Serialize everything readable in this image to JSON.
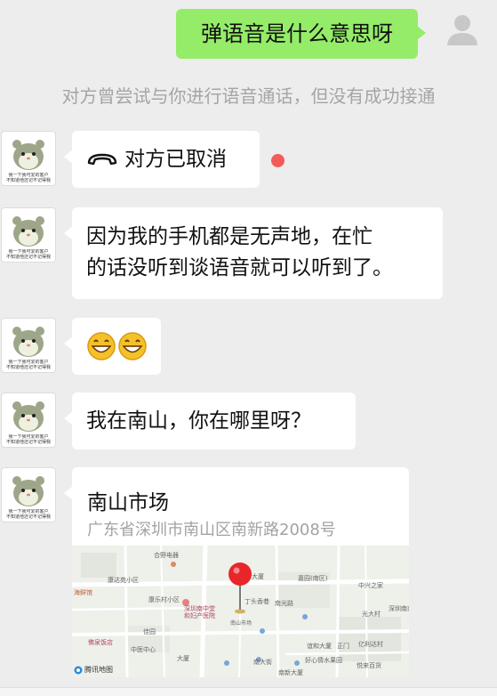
{
  "chat": {
    "outgoing_message": "弹语音是什么意思呀",
    "system_notice": "对方曾尝试与你进行语音通话，但没有成功接通",
    "call_cancelled_text": "对方已取消",
    "message_2": "因为我的手机都是无声地，在忙的话没听到谈语音就可以听到了。",
    "message_2_line1": "因为我的手机都是无声地，在忙",
    "message_2_line2": "的话没听到谈语音就可以听到了。",
    "emoji_message": "😁😁",
    "message_4": "我在南山，你在哪里呀？"
  },
  "contact": {
    "avatar_caption_line1": "我一下我可爱的客户",
    "avatar_caption_line2": "不知道他还记不记得我"
  },
  "location": {
    "name": "南山市场",
    "address": "广东省深圳市南山区南新路2008号",
    "map_provider": "腾讯地图",
    "pin_label": "南山市场",
    "map_labels": [
      "合野电器",
      "康达苑小区",
      "海鲜馆",
      "康乐村小区",
      "深圳南中堂",
      "和妇产医院",
      "丁头香巷",
      "大厦",
      "嘉园(南区)",
      "中兴之家",
      "光大村",
      "深圳南商",
      "佛泉饭店",
      "佳园",
      "正门",
      "亿利达村",
      "谊和大厦",
      "好心情水果园",
      "南新大厦",
      "悦来百货",
      "中医中心",
      "南光路",
      "南大街",
      "大厦"
    ]
  },
  "colors": {
    "background": "#ededed",
    "outgoing_bubble": "#95ec69",
    "incoming_bubble": "#ffffff",
    "unread_dot": "#f35b5b",
    "pin": "#e8262a"
  }
}
